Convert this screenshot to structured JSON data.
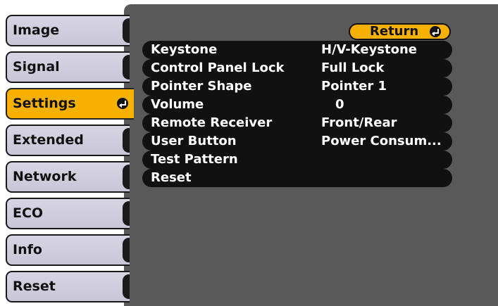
{
  "menu": {
    "tabs": [
      {
        "label": "Image",
        "selected": false
      },
      {
        "label": "Signal",
        "selected": false
      },
      {
        "label": "Settings",
        "selected": true
      },
      {
        "label": "Extended",
        "selected": false
      },
      {
        "label": "Network",
        "selected": false
      },
      {
        "label": "ECO",
        "selected": false
      },
      {
        "label": "Info",
        "selected": false
      },
      {
        "label": "Reset",
        "selected": false
      }
    ],
    "selected_icon": "enter-icon"
  },
  "return_button": {
    "label": "Return",
    "icon": "enter-icon"
  },
  "settings": {
    "rows": [
      {
        "label": "Keystone",
        "value": "H/V-Keystone"
      },
      {
        "label": "Control Panel Lock",
        "value": "Full Lock"
      },
      {
        "label": "Pointer Shape",
        "value": "Pointer 1"
      },
      {
        "label": "Volume",
        "value": "0"
      },
      {
        "label": "Remote Receiver",
        "value": "Front/Rear"
      },
      {
        "label": "User Button",
        "value": "Power Consum..."
      },
      {
        "label": "Test Pattern",
        "value": ""
      },
      {
        "label": "Reset",
        "value": ""
      }
    ]
  },
  "colors": {
    "highlight": "#f5b000",
    "panel": "#595959",
    "row": "#111111",
    "tab": "#cfcce0"
  }
}
